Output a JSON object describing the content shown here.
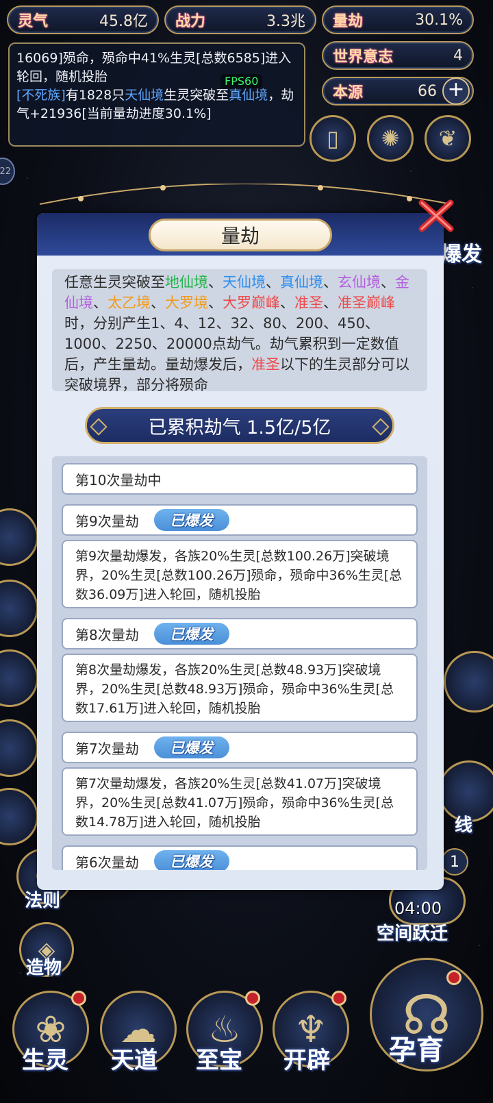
{
  "stats": {
    "lingqi": {
      "label": "灵气",
      "value": "45.8亿"
    },
    "zhanli": {
      "label": "战力",
      "value": "3.3兆"
    },
    "liangjie": {
      "label": "量劫",
      "value": "30.1%"
    },
    "shijie": {
      "label": "世界意志",
      "value": "4"
    },
    "benyuan": {
      "label": "本源",
      "value": "66",
      "plus": "+"
    }
  },
  "log": {
    "line1": "16069]殒命，殒命中41%生灵[总数6585]进入轮回，随机投胎",
    "line2_pre": "[不死族]",
    "line2_a": "有1828只",
    "line2_b": "天仙境",
    "line2_c": "生灵突破至",
    "line2_d": "真仙境",
    "line2_e": "，劫气+21936[当前量劫进度30.1%]",
    "fps": "FPS60"
  },
  "side": {
    "badge_left": "22",
    "right_partial": "爆发",
    "right_partial2": "线",
    "right_partial3": "1",
    "fa_ze": "法则",
    "zao_wu": "造物",
    "timer": "04:00",
    "kongjian": "空间跃迁"
  },
  "modal": {
    "title": "量劫",
    "desc": {
      "t1": "任意生灵突破至",
      "r1": "地仙境",
      "s": "、",
      "r2": "天仙境",
      "r3": "真仙境",
      "r4": "玄仙境",
      "r5": "金仙境",
      "r6": "太乙境",
      "r7": "大罗境",
      "r8": "大罗巅峰",
      "r9": "准圣",
      "r10": "准圣巅峰",
      "t2": "时，分别产生1、4、12、32、80、200、450、1000、2250、20000点劫气。劫气累积到一定数值后，产生量劫。量劫爆发后，",
      "r11": "准圣",
      "t3": "以下的生灵部分可以突破境界，部分将殒命"
    },
    "accumulated": "已累积劫气 1.5亿/5亿",
    "badge_text": "已爆发",
    "items": [
      {
        "head": "第10次量劫中"
      },
      {
        "head": "第9次量劫",
        "body": "第9次量劫爆发，各族20%生灵[总数100.26万]突破境界，20%生灵[总数100.26万]殒命，殒命中36%生灵[总数36.09万]进入轮回，随机投胎"
      },
      {
        "head": "第8次量劫",
        "body": "第8次量劫爆发，各族20%生灵[总数48.93万]突破境界，20%生灵[总数48.93万]殒命，殒命中36%生灵[总数17.61万]进入轮回，随机投胎"
      },
      {
        "head": "第7次量劫",
        "body": "第7次量劫爆发，各族20%生灵[总数41.07万]突破境界，20%生灵[总数41.07万]殒命，殒命中36%生灵[总数14.78万]进入轮回，随机投胎"
      },
      {
        "head": "第6次量劫"
      }
    ]
  },
  "bottom": {
    "shengling": "生灵",
    "tiandao": "天道",
    "zhibao": "至宝",
    "kaipi": "开辟",
    "yunyu": "孕育"
  },
  "colors": {
    "gold": "#b89a5c",
    "navy": "#1c2b66",
    "badge_blue": "#4b8fd8",
    "realm_green": "#23b54a",
    "realm_blue": "#2f8ff0",
    "realm_purple": "#b45fe0",
    "realm_orange": "#f29a1a",
    "realm_red": "#ee4a4a"
  }
}
